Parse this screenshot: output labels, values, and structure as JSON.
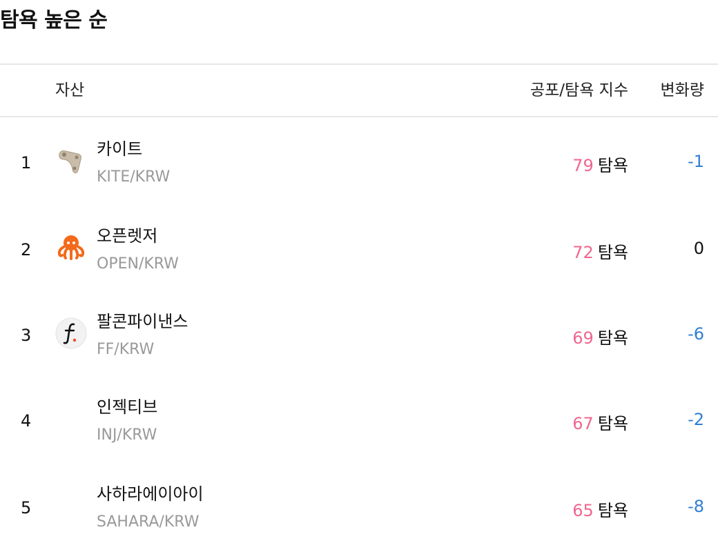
{
  "title": "탐욕 높은 순",
  "table": {
    "headers": {
      "asset": "자산",
      "index": "공포/탐욕 지수",
      "change": "변화량"
    },
    "rows": [
      {
        "rank": "1",
        "name": "카이트",
        "symbol": "KITE/KRW",
        "index_value": "79",
        "index_label": "탐욕",
        "change": "-1",
        "icon": "kite-icon"
      },
      {
        "rank": "2",
        "name": "오픈렛저",
        "symbol": "OPEN/KRW",
        "index_value": "72",
        "index_label": "탐욕",
        "change": "0",
        "icon": "octopus-icon"
      },
      {
        "rank": "3",
        "name": "팔콘파이낸스",
        "symbol": "FF/KRW",
        "index_value": "69",
        "index_label": "탐욕",
        "change": "-6",
        "icon": "falcon-finance-icon"
      },
      {
        "rank": "4",
        "name": "인젝티브",
        "symbol": "INJ/KRW",
        "index_value": "67",
        "index_label": "탐욕",
        "change": "-2",
        "icon": ""
      },
      {
        "rank": "5",
        "name": "사하라에이아이",
        "symbol": "SAHARA/KRW",
        "index_value": "65",
        "index_label": "탐욕",
        "change": "-8",
        "icon": ""
      }
    ]
  },
  "colors": {
    "greed_value": "#f0668f",
    "negative_change": "#2f7fd4",
    "symbol_text": "#999999",
    "divider": "#e6e6e6"
  }
}
